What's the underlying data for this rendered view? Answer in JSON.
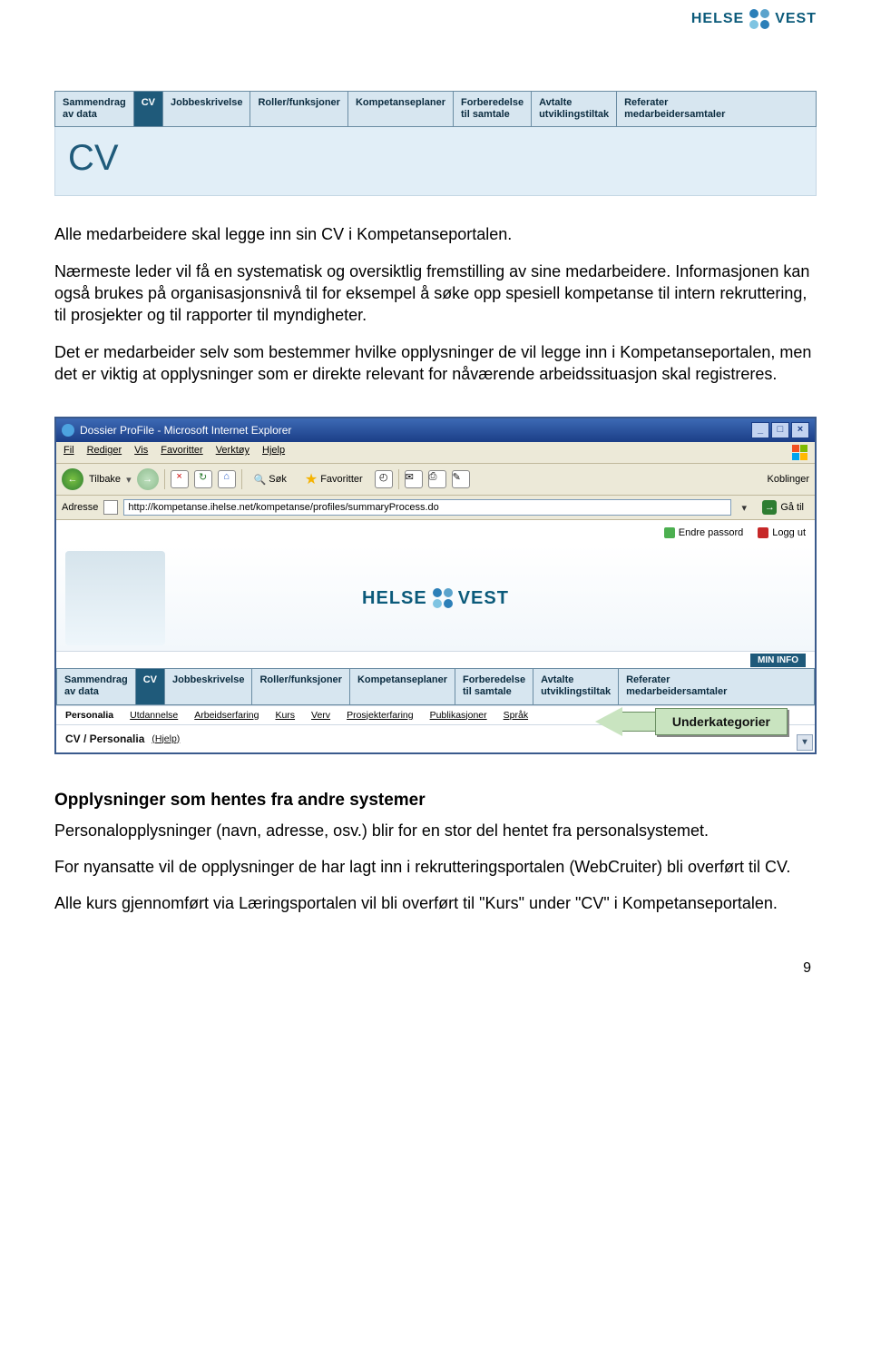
{
  "logo": {
    "left": "HELSE",
    "right": "VEST"
  },
  "topTabs": [
    "Sammendrag\nav data",
    "CV",
    "Jobbeskrivelse",
    "Roller/funksjoner",
    "Kompetanseplaner",
    "Forberedelse\ntil samtale",
    "Avtalte\nutviklingstiltak",
    "Referater\nmedarbeidersamtaler"
  ],
  "topTabsActiveIndex": 1,
  "heading": "CV",
  "para1": "Alle medarbeidere skal legge inn sin CV i Kompetanseportalen.",
  "para2": "Nærmeste leder vil få en systematisk og oversiktlig fremstilling av sine medarbeidere. Informasjonen kan også brukes på organisasjonsnivå til for eksempel å søke opp spesiell kompetanse til intern rekruttering, til prosjekter og til rapporter til myndigheter.",
  "para3": "Det er medarbeider selv som bestemmer hvilke opplysninger de vil legge inn i Kompetanseportalen, men det er viktig at opplysninger som er direkte relevant for nåværende arbeidssituasjon skal registreres.",
  "ie": {
    "title": "Dossier ProFile - Microsoft Internet Explorer",
    "menus": [
      "Fil",
      "Rediger",
      "Vis",
      "Favoritter",
      "Verktøy",
      "Hjelp"
    ],
    "back": "Tilbake",
    "search": "Søk",
    "fav": "Favoritter",
    "koblinger": "Koblinger",
    "addrLabel": "Adresse",
    "url": "http://kompetanse.ihelse.net/kompetanse/profiles/summaryProcess.do",
    "go": "Gå til",
    "changePw": "Endre passord",
    "logout": "Logg ut",
    "minInfo": "MIN INFO",
    "subcats": [
      "Personalia",
      "Utdannelse",
      "Arbeidserfaring",
      "Kurs",
      "Verv",
      "Prosjekterfaring",
      "Publikasjoner",
      "Språk"
    ],
    "crumb": "CV / Personalia",
    "help": "(Hjelp)"
  },
  "callout": "Underkategorier",
  "section2Title": "Opplysninger som hentes fra andre systemer",
  "para4": "Personalopplysninger (navn, adresse, osv.) blir for en stor del hentet fra personalsystemet.",
  "para5": "For nyansatte vil de opplysninger de har lagt inn i rekrutteringsportalen (WebCruiter) bli overført til CV.",
  "para6": "Alle kurs gjennomført via Læringsportalen vil bli overført til \"Kurs\" under \"CV\" i Kompetanseportalen.",
  "pageNumber": "9"
}
